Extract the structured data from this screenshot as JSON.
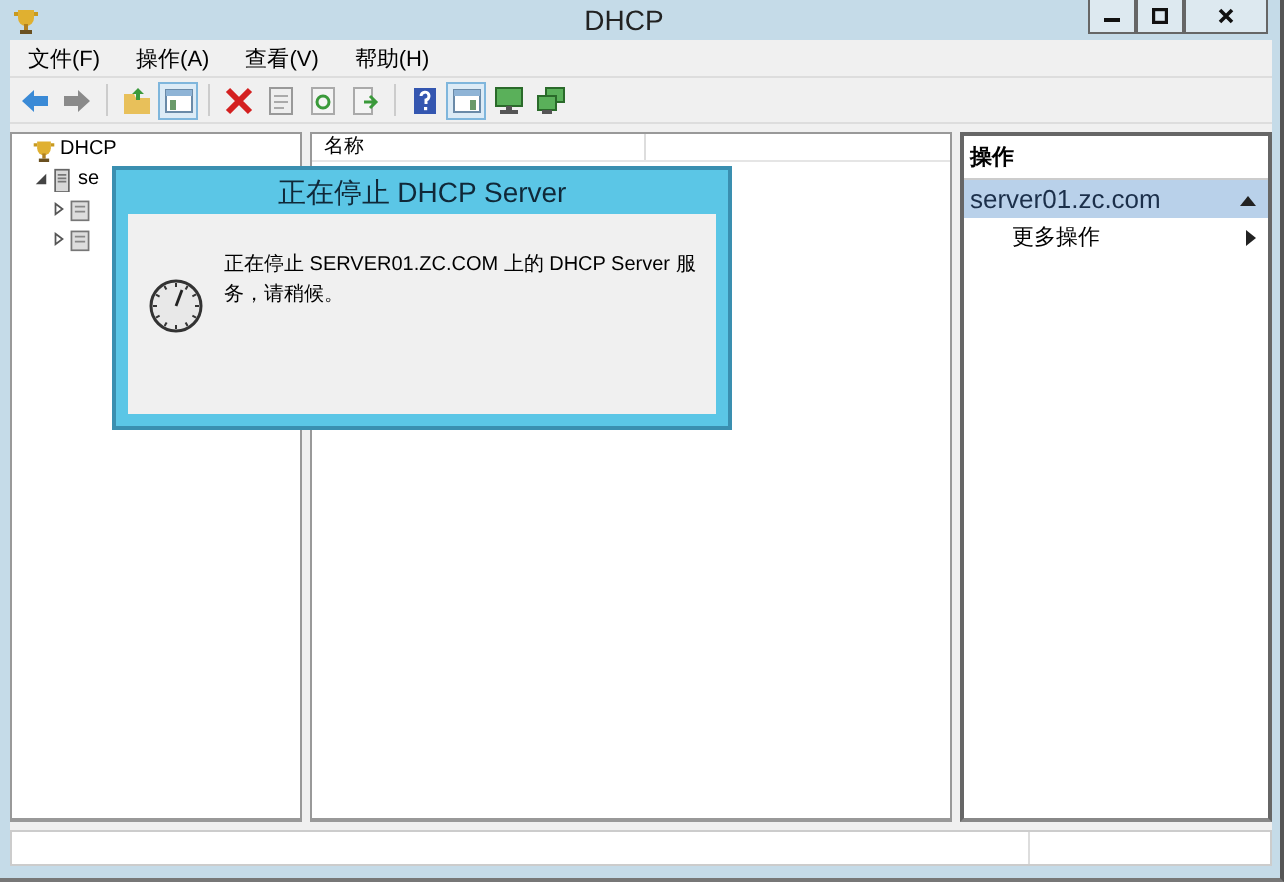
{
  "window": {
    "title": "DHCP"
  },
  "menu": [
    "文件(F)",
    "操作(A)",
    "查看(V)",
    "帮助(H)"
  ],
  "toolbar": [
    {
      "kind": "back",
      "pressed": false
    },
    {
      "kind": "forward",
      "pressed": false
    },
    {
      "kind": "sep"
    },
    {
      "kind": "up",
      "pressed": false
    },
    {
      "kind": "tree-pane",
      "pressed": true
    },
    {
      "kind": "sep"
    },
    {
      "kind": "delete",
      "pressed": false
    },
    {
      "kind": "properties",
      "pressed": false
    },
    {
      "kind": "refresh",
      "pressed": false
    },
    {
      "kind": "export",
      "pressed": false
    },
    {
      "kind": "sep"
    },
    {
      "kind": "help",
      "pressed": false
    },
    {
      "kind": "action-pane",
      "pressed": true
    },
    {
      "kind": "monitor",
      "pressed": false
    },
    {
      "kind": "monitors",
      "pressed": false
    }
  ],
  "tree": [
    {
      "label": "DHCP",
      "kind": "root",
      "children": [
        {
          "label": "se",
          "kind": "server",
          "expanded": true,
          "children": [
            {
              "kind": "scope",
              "expanded": false
            },
            {
              "kind": "scope",
              "expanded": false
            }
          ]
        }
      ]
    }
  ],
  "list": {
    "columns": [
      "名称"
    ]
  },
  "actions": {
    "title": "操作",
    "groups": [
      {
        "label": "server01.zc.com",
        "expanded": true,
        "items": [
          "更多操作"
        ]
      }
    ]
  },
  "dialog": {
    "title": "正在停止 DHCP Server",
    "message": "正在停止 SERVER01.ZC.COM 上的 DHCP Server 服务，请稍候。"
  }
}
